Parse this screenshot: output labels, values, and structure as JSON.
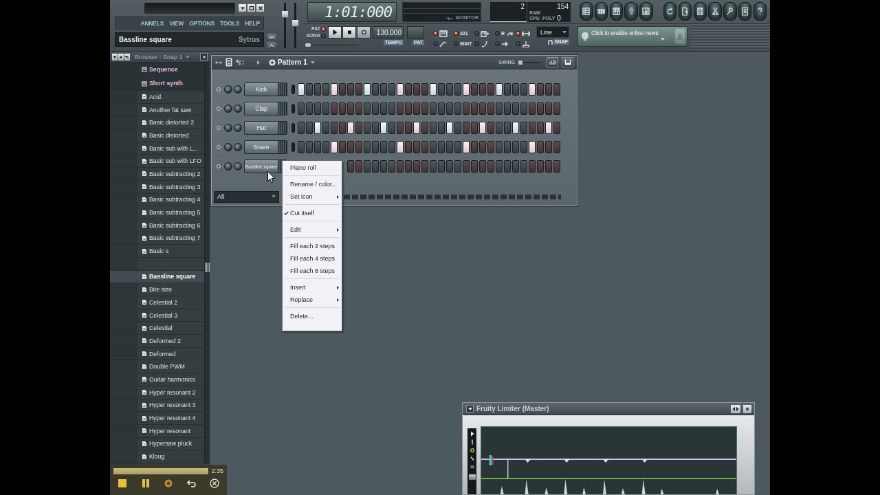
{
  "top_panel": {
    "menu": [
      "ANNELS",
      "VIEW",
      "OPTIONS",
      "TOOLS",
      "HELP"
    ],
    "hint_bar": {
      "title": "Bassline square",
      "plugin": "Sytrus"
    },
    "sliders": [
      {
        "level": 0.79
      },
      {
        "level": 0.55
      }
    ],
    "time_display": "1:01:000",
    "monitor_label": "MONITOR",
    "cpu_panel": {
      "value_1": "2",
      "value_2": "154",
      "label_1": "RAM",
      "label_2": "CPU",
      "label_3": "POLY",
      "value_3": "0"
    },
    "mode": [
      {
        "label": "PAT",
        "selected": true
      },
      {
        "label": "SONG",
        "selected": false
      }
    ],
    "song_position": {
      "level": 0
    },
    "tempo": {
      "value": "130.000",
      "label": "TEMPO"
    },
    "pattern_label": "PAT",
    "options": [
      {
        "on": true
      },
      {
        "on": true,
        "label": "321"
      },
      {
        "on": false
      },
      {
        "on": false,
        "label": "R"
      },
      {
        "on": true
      },
      {
        "on": false
      },
      {
        "on": false,
        "label": "WAIT"
      },
      {
        "on": false
      },
      {
        "on": false
      },
      {
        "on": false
      }
    ],
    "snap": {
      "value": "Line",
      "label": "SNAP"
    },
    "news": "Click to enable online news"
  },
  "browser": {
    "title": "Browser - Snap 1",
    "items": [
      {
        "label": "Sequence",
        "kind": "folder",
        "selected": false
      },
      {
        "label": "Short synth",
        "kind": "folder",
        "selected": false,
        "children": [
          {
            "label": "Acid",
            "kind": "preset",
            "selected": false
          },
          {
            "label": "Another fat saw",
            "kind": "preset",
            "selected": false
          },
          {
            "label": "Basic distorted 2",
            "kind": "preset",
            "selected": false
          },
          {
            "label": "Basic distorted",
            "kind": "preset",
            "selected": false
          },
          {
            "label": "Basic sub with L...",
            "kind": "preset",
            "selected": false
          },
          {
            "label": "Basic sub with LFO",
            "kind": "preset",
            "selected": false
          },
          {
            "label": "Basic subtracting 2",
            "kind": "preset",
            "selected": false
          },
          {
            "label": "Basic subtracting 3",
            "kind": "preset",
            "selected": false
          },
          {
            "label": "Basic subtracting 4",
            "kind": "preset",
            "selected": false
          },
          {
            "label": "Basic subtracting 5",
            "kind": "preset",
            "selected": false
          },
          {
            "label": "Basic subtracting 6",
            "kind": "preset",
            "selected": false
          },
          {
            "label": "Basic subtracting 7",
            "kind": "preset",
            "selected": false
          },
          {
            "label": "Basic s",
            "kind": "preset",
            "selected": false
          },
          {
            "kind": "blank"
          },
          {
            "label": "Bassline square",
            "kind": "preset",
            "selected": true
          },
          {
            "label": "Bite size",
            "kind": "preset",
            "selected": false
          },
          {
            "label": "Celestial 2",
            "kind": "preset",
            "selected": false
          },
          {
            "label": "Celestial 3",
            "kind": "preset",
            "selected": false
          },
          {
            "label": "Celestial",
            "kind": "preset",
            "selected": false
          },
          {
            "label": "Deformed 2",
            "kind": "preset",
            "selected": false
          },
          {
            "label": "Deformed",
            "kind": "preset",
            "selected": false
          },
          {
            "label": "Double PWM",
            "kind": "preset",
            "selected": false
          },
          {
            "label": "Guitar harmonics",
            "kind": "preset",
            "selected": false
          },
          {
            "label": "Hyper resonant 2",
            "kind": "preset",
            "selected": false
          },
          {
            "label": "Hyper resonant 3",
            "kind": "preset",
            "selected": false
          },
          {
            "label": "Hyper resonant 4",
            "kind": "preset",
            "selected": false
          },
          {
            "label": "Hyper resonant",
            "kind": "preset",
            "selected": false
          },
          {
            "label": "Hypersaw pluck",
            "kind": "preset",
            "selected": false
          },
          {
            "label": "Kloug",
            "kind": "preset",
            "selected": false
          }
        ]
      }
    ]
  },
  "step_sequencer": {
    "pattern": "Pattern 1",
    "swing": {
      "label": "SWING",
      "level": 0
    },
    "channels": [
      {
        "name": "Kick",
        "selected": false,
        "steps": [
          true,
          false,
          false,
          false,
          true,
          false,
          false,
          false,
          true,
          false,
          false,
          false,
          true,
          false,
          false,
          false,
          true,
          false,
          false,
          false,
          true,
          false,
          false,
          false,
          true,
          false,
          false,
          false,
          true,
          false,
          false,
          false
        ]
      },
      {
        "name": "Clap",
        "selected": false,
        "steps": [
          false,
          false,
          false,
          false,
          false,
          false,
          false,
          false,
          false,
          false,
          false,
          false,
          false,
          false,
          false,
          false,
          false,
          false,
          false,
          false,
          false,
          false,
          false,
          false,
          false,
          false,
          false,
          false,
          false,
          false,
          false,
          false
        ]
      },
      {
        "name": "Hat",
        "selected": false,
        "steps": [
          false,
          false,
          true,
          false,
          false,
          false,
          true,
          false,
          false,
          false,
          true,
          false,
          false,
          false,
          true,
          false,
          false,
          false,
          true,
          false,
          false,
          false,
          true,
          false,
          false,
          false,
          true,
          false,
          false,
          false,
          true,
          false
        ]
      },
      {
        "name": "Snare",
        "selected": false,
        "steps": [
          false,
          false,
          false,
          false,
          true,
          false,
          false,
          false,
          false,
          false,
          false,
          false,
          true,
          false,
          false,
          false,
          false,
          false,
          false,
          false,
          true,
          false,
          false,
          false,
          false,
          false,
          false,
          false,
          true,
          false,
          false,
          false
        ]
      },
      {
        "name": "Bassline square",
        "steps": [
          false,
          false,
          false,
          false,
          false,
          false,
          false,
          false,
          false,
          false,
          false,
          false,
          false,
          false,
          false,
          false,
          false,
          false,
          false,
          false,
          false,
          false,
          false,
          false,
          false,
          false
        ]
      }
    ],
    "filter": "All"
  },
  "context_menu": [
    {
      "kind": "item",
      "label": "Piano roll",
      "checked": false,
      "submenu": false
    },
    {
      "kind": "separator"
    },
    {
      "kind": "item",
      "label": "Rename / color...",
      "checked": false,
      "submenu": false
    },
    {
      "kind": "item",
      "label": "Set icon",
      "checked": false,
      "submenu": true
    },
    {
      "kind": "separator"
    },
    {
      "kind": "item",
      "label": "Cut itself",
      "checked": true,
      "submenu": false
    },
    {
      "kind": "separator"
    },
    {
      "kind": "item",
      "label": "Edit",
      "checked": false,
      "submenu": true
    },
    {
      "kind": "separator"
    },
    {
      "kind": "item",
      "label": "Fill each 2 steps",
      "checked": false,
      "submenu": false
    },
    {
      "kind": "item",
      "label": "Fill each 4 steps",
      "checked": false,
      "submenu": false
    },
    {
      "kind": "item",
      "label": "Fill each 8 steps",
      "checked": false,
      "submenu": false
    },
    {
      "kind": "separator"
    },
    {
      "kind": "item",
      "label": "Insert",
      "checked": false,
      "submenu": true
    },
    {
      "kind": "item",
      "label": "Replace",
      "checked": false,
      "submenu": true
    },
    {
      "kind": "separator"
    },
    {
      "kind": "item",
      "label": "Delete...",
      "checked": false,
      "submenu": false
    }
  ],
  "limiter": {
    "title": "Fruity Limiter (Master)"
  },
  "recorder": {
    "time": "2:35"
  }
}
